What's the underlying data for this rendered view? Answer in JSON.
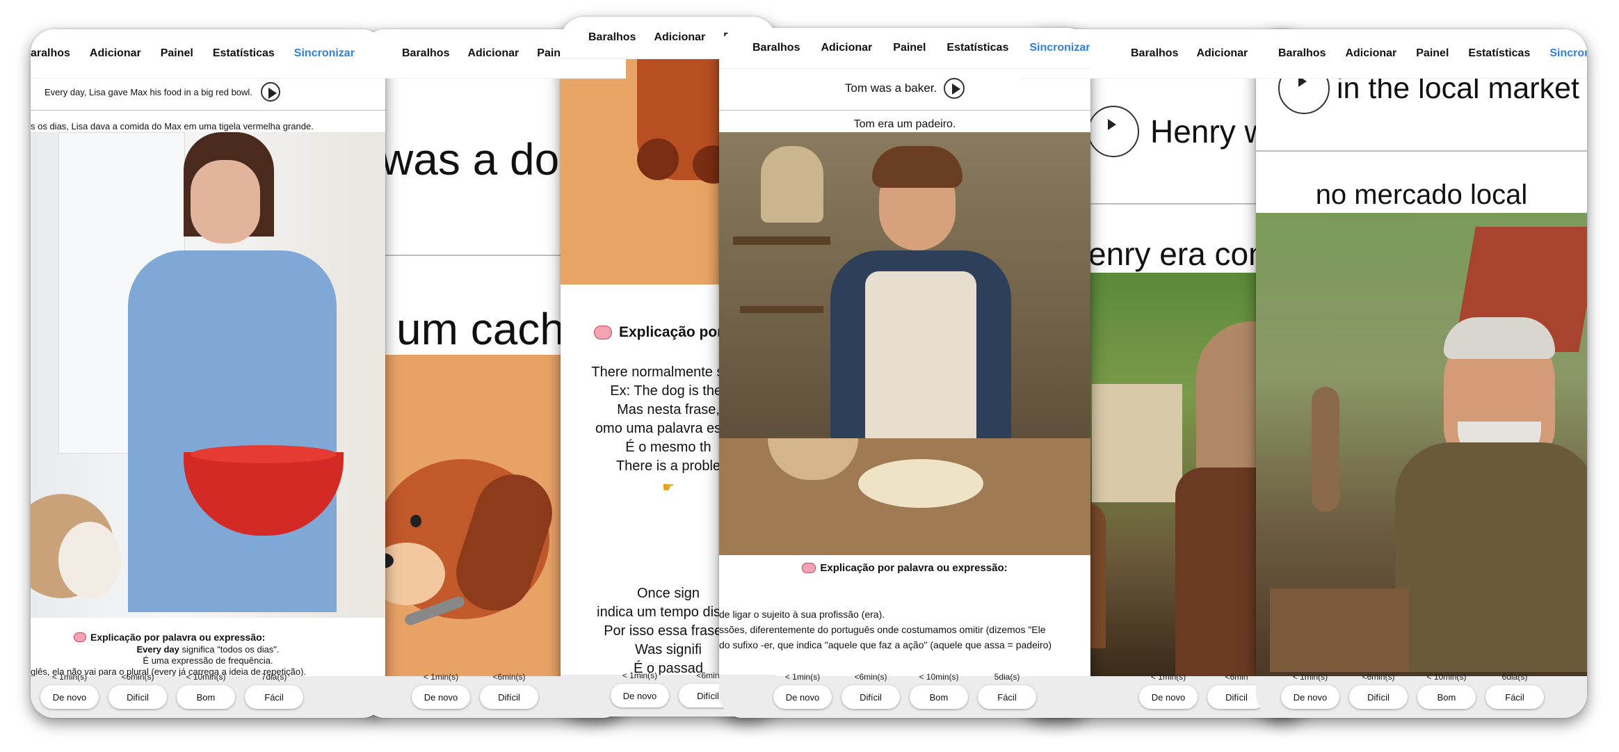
{
  "nav": {
    "decks": "Baralhos",
    "add": "Adicionar",
    "dashboard": "Painel",
    "stats": "Estatísticas",
    "sync": "Sincronizar",
    "decks_cut": "baralhos"
  },
  "buttons": {
    "again": "De novo",
    "hard": "Difícil",
    "good": "Bom",
    "easy": "Fácil"
  },
  "card1": {
    "question": "Every day, Lisa gave Max his food in a big red bowl.",
    "answer": "s os dias, Lisa dava a comida do Max em uma tigela vermelha grande.",
    "expl_title": "Explicação por palavra ou expressão:",
    "expl_term": "Every day",
    "expl_line1": "significa \"todos os dias\".",
    "expl_line2": "É uma expressão de frequência.",
    "expl_line3": "glês, ela não vai para o plural (every já carrega a ideia de repetição).",
    "times": [
      "< 1min(s)",
      "<6min(s)",
      "< 10min(s)",
      "7dia(s)"
    ]
  },
  "card2": {
    "question": "was a dog",
    "answer": "um cach",
    "times": [
      "< 1min(s)",
      "<6min(s)"
    ]
  },
  "card3": {
    "expl_title": "Explicação por",
    "lines": [
      "There normalmente signi",
      "Ex: The dog is ther",
      "Mas nesta frase,",
      "omo uma palavra estrut",
      "É o mesmo th",
      "There is a proble"
    ],
    "lines2": [
      "Once sign",
      "indica um tempo distan",
      "Por isso essa frase s",
      "Was signifi",
      "É o passad"
    ],
    "times": [
      "< 1min(s)",
      "<6min"
    ]
  },
  "card4": {
    "question": "Tom was a baker.",
    "answer": "Tom era um padeiro.",
    "expl_title": "Explicação por palavra ou expressão:",
    "expl_line1": "de ligar o sujeito à sua profissão (era).",
    "expl_line2": "ssões, diferentemente do português onde costumamos omitir (dizemos \"Ele",
    "expl_line3": "do sufixo -er, que indica \"aquele que faz a ação\" (aquele que assa = padeiro)",
    "times": [
      "< 1min(s)",
      "<6min(s)",
      "< 10min(s)",
      "5dia(s)"
    ]
  },
  "card5": {
    "question": "Henry w",
    "answer": "enry era con",
    "times": [
      "< 1min(s)",
      "<6min"
    ]
  },
  "card6": {
    "question": "in the local market",
    "answer": "no mercado local",
    "times": [
      "< 1min(s)",
      "<6min(s)",
      "< 10min(s)",
      "6dia(s)"
    ]
  },
  "icons": {
    "play": "play-icon",
    "brain": "brain-icon",
    "pointing": "pointing-hand-icon"
  },
  "colors": {
    "sync": "#2f7fde",
    "footer": "#ececec",
    "bowl": "#d42a26",
    "dog": "#c2592a",
    "shirt": "#7fa8d6"
  }
}
